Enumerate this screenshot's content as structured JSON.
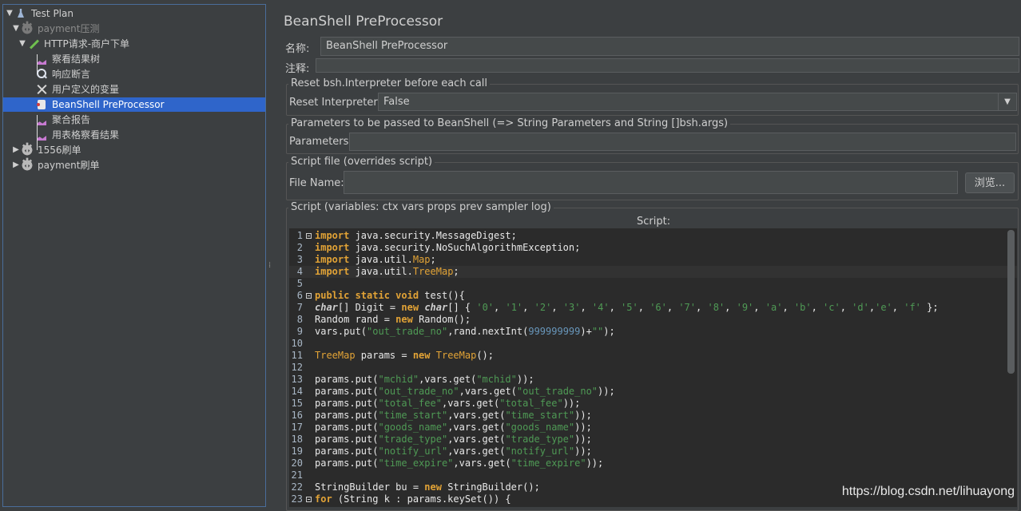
{
  "tree": {
    "nodes": [
      {
        "label": "Test Plan",
        "icon": "flask-icon",
        "expanded": true
      },
      {
        "label": "payment压测",
        "icon": "gear-icon",
        "expanded": true,
        "disabled": true
      },
      {
        "label": "HTTP请求-商户下单",
        "icon": "pen-icon",
        "expanded": true
      },
      {
        "label": "察看结果树",
        "icon": "graph-icon"
      },
      {
        "label": "响应断言",
        "icon": "magnifier-icon"
      },
      {
        "label": "用户定义的变量",
        "icon": "tools-icon"
      },
      {
        "label": "BeanShell PreProcessor",
        "icon": "bean-icon",
        "selected": true
      },
      {
        "label": "聚合报告",
        "icon": "graph-icon"
      },
      {
        "label": "用表格察看结果",
        "icon": "graph-icon"
      },
      {
        "label": "1556刷单",
        "icon": "gear-icon",
        "expanded": false
      },
      {
        "label": "payment刷单",
        "icon": "gear-icon",
        "expanded": false
      }
    ]
  },
  "panel": {
    "title": "BeanShell PreProcessor",
    "name_label": "名称:",
    "name_value": "BeanShell PreProcessor",
    "comment_label": "注释:",
    "comment_value": "",
    "reset_group_title": "Reset bsh.Interpreter before each call",
    "reset_label": "Reset Interpreter:",
    "reset_value": "False",
    "params_group_title": "Parameters to be passed to BeanShell (=> String Parameters and String []bsh.args)",
    "params_label": "Parameters:",
    "params_value": "",
    "file_group_title": "Script file (overrides script)",
    "file_label": "File Name:",
    "file_value": "",
    "browse_label": "浏览...",
    "script_group_title": "Script (variables: ctx vars props prev sampler log)",
    "script_label": "Script:"
  },
  "editor": {
    "lines": [
      {
        "n": "1",
        "fold": true,
        "segs": [
          [
            "kw",
            "import"
          ],
          [
            "",
            " java.security.MessageDigest;"
          ]
        ]
      },
      {
        "n": "2",
        "segs": [
          [
            "kw",
            "import"
          ],
          [
            "",
            " java.security.NoSuchAlgorithmException;"
          ]
        ]
      },
      {
        "n": "3",
        "segs": [
          [
            "kw",
            "import"
          ],
          [
            "",
            " java.util."
          ],
          [
            "ty",
            "Map"
          ],
          [
            "",
            ";"
          ]
        ]
      },
      {
        "n": "4",
        "cur": true,
        "segs": [
          [
            "kw",
            "import"
          ],
          [
            "",
            " java.util."
          ],
          [
            "ty",
            "TreeMap"
          ],
          [
            "",
            ";"
          ]
        ]
      },
      {
        "n": "5",
        "segs": []
      },
      {
        "n": "6",
        "fold": true,
        "segs": [
          [
            "kw",
            "public static void"
          ],
          [
            "",
            " test(){"
          ]
        ]
      },
      {
        "n": "7",
        "segs": [
          [
            "kwi",
            "char"
          ],
          [
            "",
            "[] Digit = "
          ],
          [
            "kw",
            "new"
          ],
          [
            "",
            " "
          ],
          [
            "kwi",
            "char"
          ],
          [
            "",
            "[] { "
          ],
          [
            "str",
            "'0'"
          ],
          [
            "",
            ", "
          ],
          [
            "str",
            "'1'"
          ],
          [
            "",
            ", "
          ],
          [
            "str",
            "'2'"
          ],
          [
            "",
            ", "
          ],
          [
            "str",
            "'3'"
          ],
          [
            "",
            ", "
          ],
          [
            "str",
            "'4'"
          ],
          [
            "",
            ", "
          ],
          [
            "str",
            "'5'"
          ],
          [
            "",
            ", "
          ],
          [
            "str",
            "'6'"
          ],
          [
            "",
            ", "
          ],
          [
            "str",
            "'7'"
          ],
          [
            "",
            ", "
          ],
          [
            "str",
            "'8'"
          ],
          [
            "",
            ", "
          ],
          [
            "str",
            "'9'"
          ],
          [
            "",
            ", "
          ],
          [
            "str",
            "'a'"
          ],
          [
            "",
            ", "
          ],
          [
            "str",
            "'b'"
          ],
          [
            "",
            ", "
          ],
          [
            "str",
            "'c'"
          ],
          [
            "",
            ", "
          ],
          [
            "str",
            "'d'"
          ],
          [
            "",
            ","
          ],
          [
            "str",
            "'e'"
          ],
          [
            "",
            ", "
          ],
          [
            "str",
            "'f'"
          ],
          [
            "",
            " };"
          ]
        ]
      },
      {
        "n": "8",
        "segs": [
          [
            "",
            "Random rand = "
          ],
          [
            "kw",
            "new"
          ],
          [
            "",
            " Random();"
          ]
        ]
      },
      {
        "n": "9",
        "segs": [
          [
            "",
            "vars.put("
          ],
          [
            "str",
            "\"out_trade_no\""
          ],
          [
            "",
            ",rand.nextInt("
          ],
          [
            "num",
            "999999999"
          ],
          [
            "",
            ")+"
          ],
          [
            "str",
            "\"\""
          ],
          [
            "",
            ");"
          ]
        ]
      },
      {
        "n": "10",
        "segs": []
      },
      {
        "n": "11",
        "segs": [
          [
            "ty",
            "TreeMap"
          ],
          [
            "",
            " params = "
          ],
          [
            "kw",
            "new"
          ],
          [
            "",
            " "
          ],
          [
            "ty",
            "TreeMap"
          ],
          [
            "",
            "();"
          ]
        ]
      },
      {
        "n": "12",
        "segs": []
      },
      {
        "n": "13",
        "segs": [
          [
            "",
            "params.put("
          ],
          [
            "str",
            "\"mchid\""
          ],
          [
            "",
            ",vars.get("
          ],
          [
            "str",
            "\"mchid\""
          ],
          [
            "",
            "));"
          ]
        ]
      },
      {
        "n": "14",
        "segs": [
          [
            "",
            "params.put("
          ],
          [
            "str",
            "\"out_trade_no\""
          ],
          [
            "",
            ",vars.get("
          ],
          [
            "str",
            "\"out_trade_no\""
          ],
          [
            "",
            "));"
          ]
        ]
      },
      {
        "n": "15",
        "segs": [
          [
            "",
            "params.put("
          ],
          [
            "str",
            "\"total_fee\""
          ],
          [
            "",
            ",vars.get("
          ],
          [
            "str",
            "\"total_fee\""
          ],
          [
            "",
            "));"
          ]
        ]
      },
      {
        "n": "16",
        "segs": [
          [
            "",
            "params.put("
          ],
          [
            "str",
            "\"time_start\""
          ],
          [
            "",
            ",vars.get("
          ],
          [
            "str",
            "\"time_start\""
          ],
          [
            "",
            "));"
          ]
        ]
      },
      {
        "n": "17",
        "segs": [
          [
            "",
            "params.put("
          ],
          [
            "str",
            "\"goods_name\""
          ],
          [
            "",
            ",vars.get("
          ],
          [
            "str",
            "\"goods_name\""
          ],
          [
            "",
            "));"
          ]
        ]
      },
      {
        "n": "18",
        "segs": [
          [
            "",
            "params.put("
          ],
          [
            "str",
            "\"trade_type\""
          ],
          [
            "",
            ",vars.get("
          ],
          [
            "str",
            "\"trade_type\""
          ],
          [
            "",
            "));"
          ]
        ]
      },
      {
        "n": "19",
        "segs": [
          [
            "",
            "params.put("
          ],
          [
            "str",
            "\"notify_url\""
          ],
          [
            "",
            ",vars.get("
          ],
          [
            "str",
            "\"notify_url\""
          ],
          [
            "",
            "));"
          ]
        ]
      },
      {
        "n": "20",
        "segs": [
          [
            "",
            "params.put("
          ],
          [
            "str",
            "\"time_expire\""
          ],
          [
            "",
            ",vars.get("
          ],
          [
            "str",
            "\"time_expire\""
          ],
          [
            "",
            "));"
          ]
        ]
      },
      {
        "n": "21",
        "segs": []
      },
      {
        "n": "22",
        "segs": [
          [
            "",
            "StringBuilder bu = "
          ],
          [
            "kw",
            "new"
          ],
          [
            "",
            " StringBuilder();"
          ]
        ]
      },
      {
        "n": "23",
        "fold": true,
        "segs": [
          [
            "kw",
            "for"
          ],
          [
            "",
            " (String k : params.keySet()) {"
          ]
        ]
      }
    ]
  },
  "watermark": "https://blog.csdn.net/lihuayong"
}
